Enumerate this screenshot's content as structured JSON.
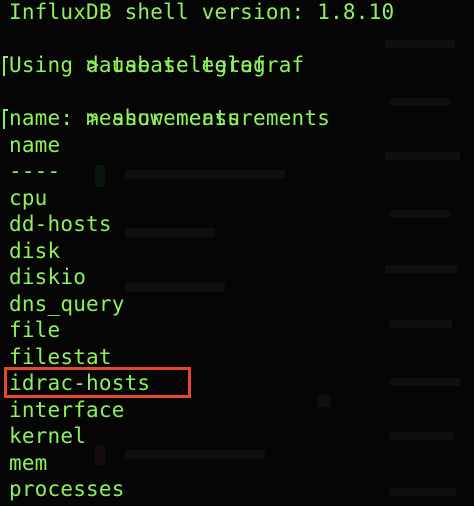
{
  "terminal": {
    "header": "InfluxDB shell version: 1.8.10",
    "commands": [
      {
        "prompt": ">",
        "command": "use telegraf"
      },
      {
        "prompt": ">",
        "command": "show measurements"
      }
    ],
    "output_using": "Using database telegraf",
    "result_name": "name: measurements",
    "column_header": "name",
    "column_separator": "----",
    "measurements": [
      "cpu",
      "dd-hosts",
      "disk",
      "diskio",
      "dns_query",
      "file",
      "filestat",
      "idrac-hosts",
      "interface",
      "kernel",
      "mem",
      "processes"
    ],
    "highlighted_measurement": "idrac-hosts"
  },
  "colors": {
    "text": "#8df25a",
    "background": "#050505",
    "highlight_border": "#e04a2a"
  }
}
